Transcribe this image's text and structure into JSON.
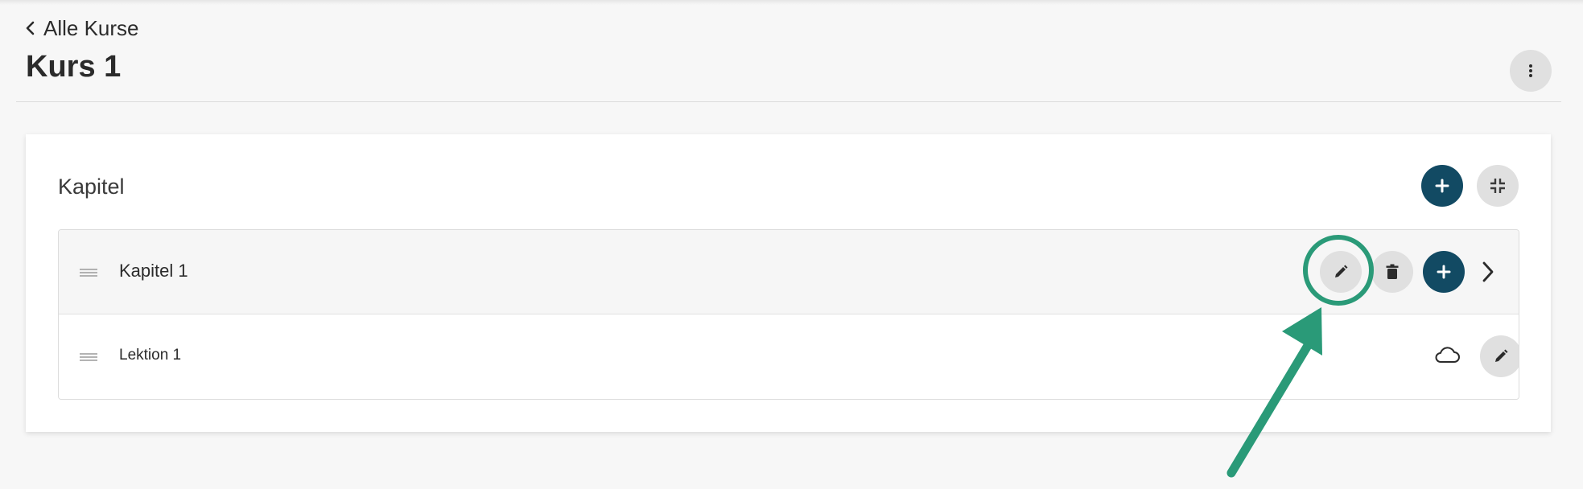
{
  "header": {
    "back_label": "Alle Kurse",
    "title": "Kurs 1",
    "more_icon": "more-vertical-icon"
  },
  "chapters_section": {
    "title": "Kapitel",
    "add_icon": "plus-icon",
    "collapse_icon": "collapse-icon",
    "chapters": [
      {
        "label": "Kapitel 1",
        "icons": [
          "drag-handle-icon",
          "pencil-icon",
          "trash-icon",
          "plus-icon",
          "chevron-right-icon"
        ],
        "lessons": [
          {
            "label": "Lektion 1",
            "icons": [
              "drag-handle-icon",
              "cloud-icon",
              "pencil-icon"
            ]
          }
        ]
      }
    ]
  },
  "annotation": {
    "color": "#2a9a78",
    "shapes": [
      "highlight-circle",
      "arrow"
    ]
  },
  "colors": {
    "primary": "#124a63",
    "secondary_button": "#e0e0e0",
    "background": "#f7f7f7"
  }
}
